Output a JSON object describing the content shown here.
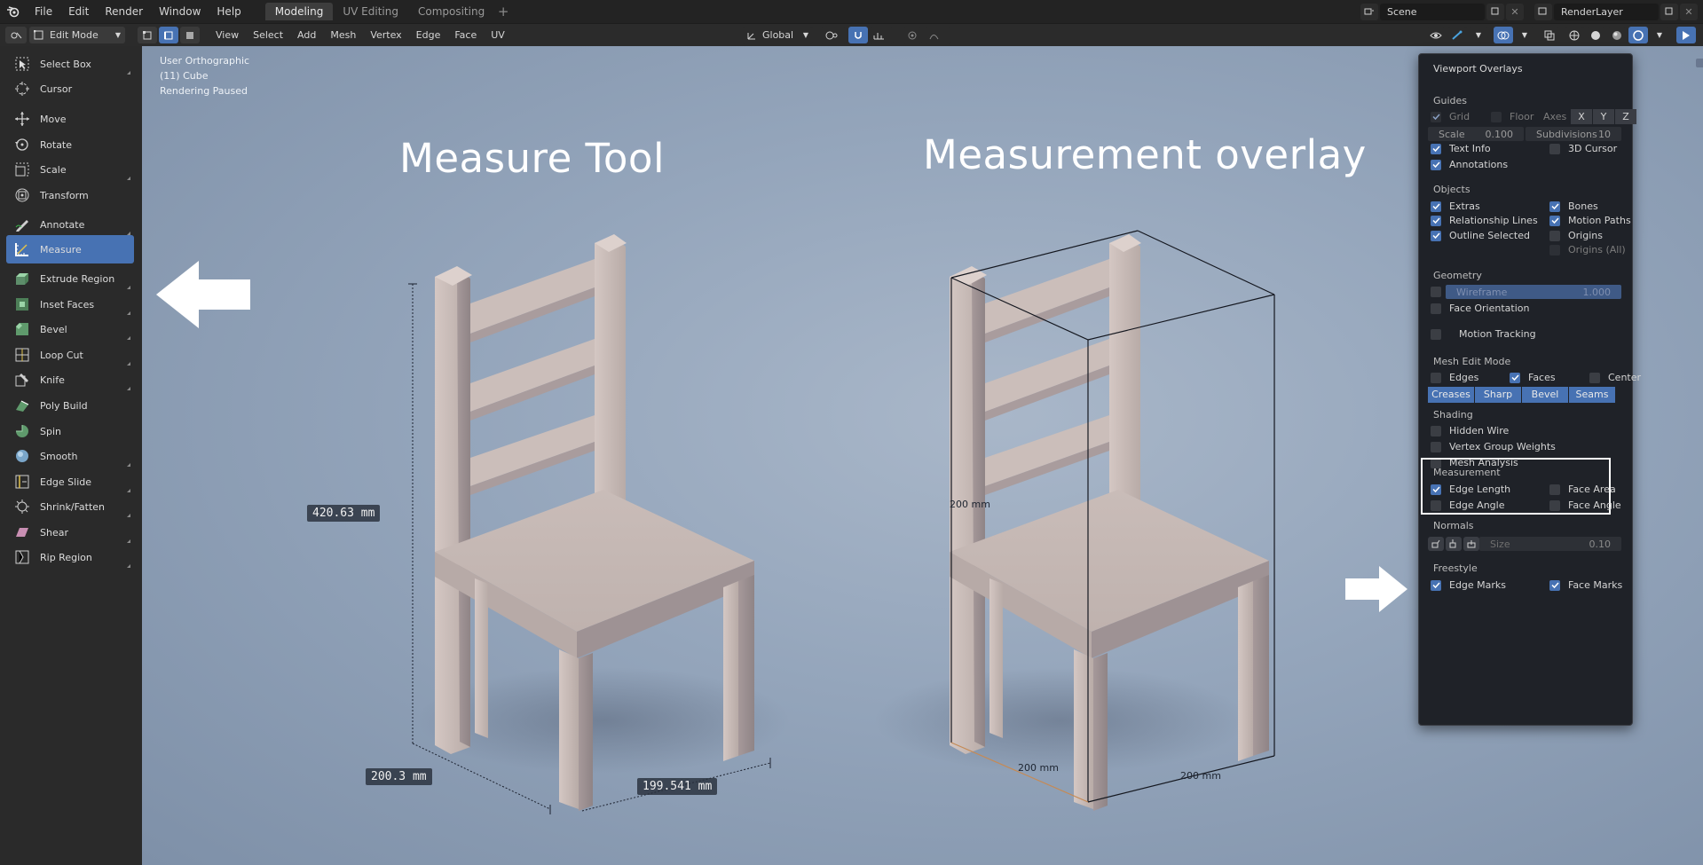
{
  "topbar": {
    "menus": [
      "File",
      "Edit",
      "Render",
      "Window",
      "Help"
    ],
    "workspaces": [
      {
        "label": "Modeling",
        "active": true
      },
      {
        "label": "UV Editing",
        "active": false
      },
      {
        "label": "Compositing",
        "active": false
      }
    ],
    "add_tab": "+",
    "scene": "Scene",
    "render_layer": "RenderLayer"
  },
  "header": {
    "mode": "Edit Mode",
    "menus": [
      "View",
      "Select",
      "Add",
      "Mesh",
      "Vertex",
      "Edge",
      "Face",
      "UV"
    ],
    "transform_orientation": "Global"
  },
  "toolbar": {
    "tools": [
      {
        "label": "Select Box",
        "icon": "select-box-icon"
      },
      {
        "label": "Cursor",
        "icon": "cursor-icon"
      },
      {
        "label": "Move",
        "icon": "move-icon"
      },
      {
        "label": "Rotate",
        "icon": "rotate-icon"
      },
      {
        "label": "Scale",
        "icon": "scale-icon"
      },
      {
        "label": "Transform",
        "icon": "transform-icon"
      },
      {
        "label": "Annotate",
        "icon": "annotate-icon"
      },
      {
        "label": "Measure",
        "icon": "measure-icon",
        "active": true
      },
      {
        "label": "Extrude Region",
        "icon": "extrude-icon"
      },
      {
        "label": "Inset Faces",
        "icon": "inset-icon"
      },
      {
        "label": "Bevel",
        "icon": "bevel-icon"
      },
      {
        "label": "Loop Cut",
        "icon": "loop-cut-icon"
      },
      {
        "label": "Knife",
        "icon": "knife-icon"
      },
      {
        "label": "Poly Build",
        "icon": "poly-build-icon"
      },
      {
        "label": "Spin",
        "icon": "spin-icon"
      },
      {
        "label": "Smooth",
        "icon": "smooth-icon"
      },
      {
        "label": "Edge Slide",
        "icon": "edge-slide-icon"
      },
      {
        "label": "Shrink/Fatten",
        "icon": "shrink-fatten-icon"
      },
      {
        "label": "Shear",
        "icon": "shear-icon"
      },
      {
        "label": "Rip Region",
        "icon": "rip-icon"
      }
    ]
  },
  "viewport": {
    "view_name": "User Orthographic",
    "object_name": "(11) Cube",
    "render_status": "Rendering Paused",
    "title_left": "Measure Tool",
    "title_right": "Measurement overlay",
    "measure_height": "420.63 mm",
    "measure_depth": "200.3 mm",
    "measure_width": "199.541 mm",
    "overlay_height": "200 mm",
    "overlay_depth": "200 mm",
    "overlay_width": "200 mm"
  },
  "overlays": {
    "title": "Viewport Overlays",
    "guides": {
      "header": "Guides",
      "grid": "Grid",
      "grid_on": true,
      "floor": "Floor",
      "floor_on": false,
      "axes": "Axes",
      "axis_labels": [
        "X",
        "Y",
        "Z"
      ],
      "scale_label": "Scale",
      "scale_value": "0.100",
      "subdiv_label": "Subdivisions",
      "subdiv_value": "10",
      "text_info": "Text Info",
      "text_info_on": true,
      "cursor_3d": "3D Cursor",
      "cursor_3d_on": false,
      "annotations": "Annotations",
      "annotations_on": true
    },
    "objects": {
      "header": "Objects",
      "extras": "Extras",
      "bones": "Bones",
      "relationship_lines": "Relationship Lines",
      "motion_paths": "Motion Paths",
      "outline_selected": "Outline Selected",
      "origins": "Origins",
      "origins_all": "Origins (All)"
    },
    "geometry": {
      "header": "Geometry",
      "wireframe": "Wireframe",
      "wireframe_value": "1.000",
      "face_orientation": "Face Orientation",
      "motion_tracking": "Motion Tracking"
    },
    "mesh_edit": {
      "header": "Mesh Edit Mode",
      "edges": "Edges",
      "faces": "Faces",
      "center": "Center",
      "buttons": [
        "Creases",
        "Sharp",
        "Bevel",
        "Seams"
      ]
    },
    "shading": {
      "header": "Shading",
      "hidden_wire": "Hidden Wire",
      "vertex_group_weights": "Vertex Group Weights",
      "mesh_analysis": "Mesh Analysis"
    },
    "measurement": {
      "header": "Measurement",
      "edge_length": "Edge Length",
      "face_area": "Face Area",
      "edge_angle": "Edge Angle",
      "face_angle": "Face Angle"
    },
    "normals": {
      "header": "Normals",
      "size_label": "Size",
      "size_value": "0.10"
    },
    "freestyle": {
      "header": "Freestyle",
      "edge_marks": "Edge Marks",
      "face_marks": "Face Marks"
    }
  },
  "colors": {
    "accent": "#4772b3",
    "panel": "#1f2228",
    "viewport_bg": "#94a5bb"
  }
}
